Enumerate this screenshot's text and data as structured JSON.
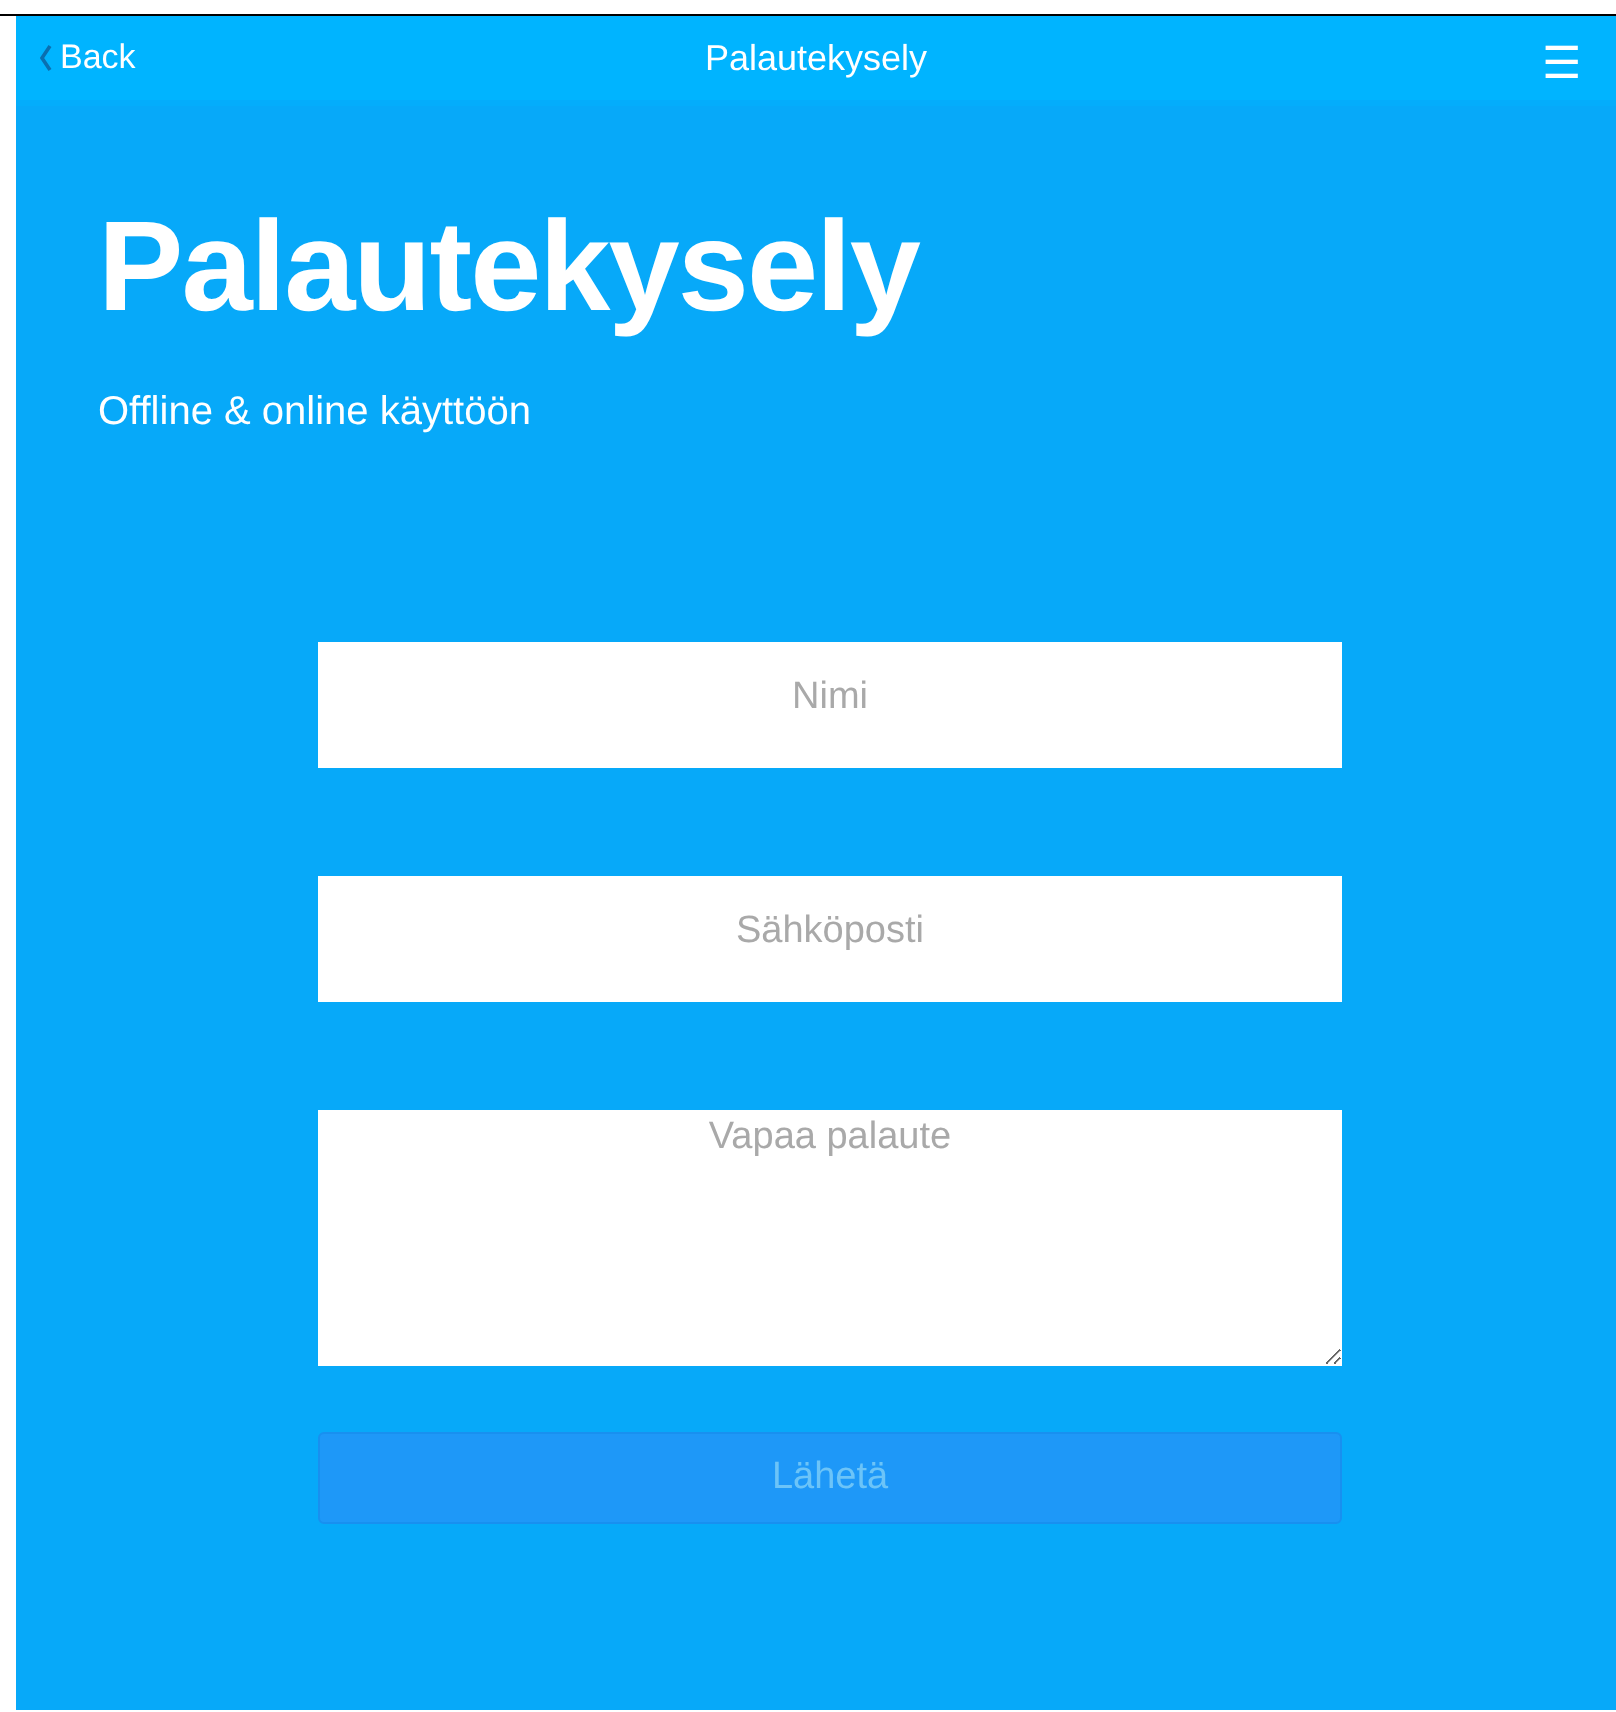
{
  "header": {
    "back": "Back",
    "title": "Palautekysely",
    "menu": "☰"
  },
  "hero": {
    "title": "Palautekysely",
    "subtitle": "Offline & online käyttöön"
  },
  "fields": [
    {
      "kind": "input",
      "placeholder": "Nimi"
    },
    {
      "kind": "input",
      "placeholder": "Sähköposti"
    },
    {
      "kind": "textarea",
      "placeholder": "Vapaa palaute"
    }
  ],
  "submit": {
    "label": "Lähetä",
    "disabled": true
  }
}
